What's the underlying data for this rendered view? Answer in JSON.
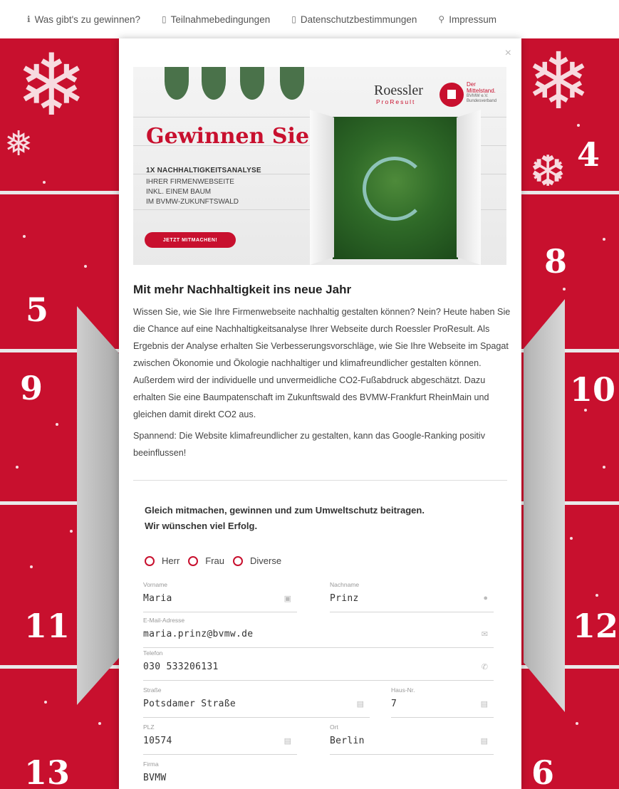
{
  "nav": {
    "items": [
      {
        "icon": "info-icon",
        "glyph": "ℹ",
        "label": "Was gibt's zu gewinnen?"
      },
      {
        "icon": "document-icon",
        "glyph": "🗎",
        "label": "Teilnahmebedingungen"
      },
      {
        "icon": "document-icon",
        "glyph": "🗎",
        "label": "Datenschutzbestimmungen"
      },
      {
        "icon": "people-icon",
        "glyph": "ꓤ",
        "label": "Impressum"
      }
    ]
  },
  "calendar": {
    "numbers": [
      "4",
      "5",
      "8",
      "9",
      "10",
      "11",
      "12",
      "13",
      "6"
    ]
  },
  "modal": {
    "close": "×",
    "banner": {
      "title": "Gewinnen Sie",
      "line1": "1X NACHHALTIGKEITSANALYSE",
      "line2": "IHRER FIRMENWEBSEITE",
      "line3": "INKL. EINEM BAUM",
      "line4": "IM BVMW-ZUKUNFTSWALD",
      "cta": "JETZT MITMACHEN!",
      "logo_roessler": "Roessler",
      "logo_proresult": "ProResult",
      "logo_mittelstand_1": "Der",
      "logo_mittelstand_2": "Mittelstand.",
      "logo_mittelstand_3": "BVMW e.V.",
      "logo_mittelstand_4": "Bundesverband"
    },
    "heading": "Mit mehr Nachhaltigkeit ins neue Jahr",
    "paragraph1": "Wissen Sie, wie Sie Ihre Firmenwebseite nachhaltig gestalten können? Nein? Heute haben Sie die Chance auf eine Nachhaltigkeitsanalyse Ihrer Webseite durch Roessler ProResult. Als Ergebnis der Analyse erhalten Sie Verbesserungsvorschläge, wie Sie Ihre Webseite im Spagat zwischen Ökonomie und Ökologie nachhaltiger und klimafreundlicher gestalten können. Außerdem wird der individuelle und unvermeidliche CO2-Fußabdruck abgeschätzt. Dazu erhalten Sie eine Baumpatenschaft im Zukunftswald des BVMW-Frankfurt RheinMain und gleichen damit direkt CO2 aus.",
    "paragraph2": "Spannend: Die Website klimafreundlicher zu gestalten, kann das Google-Ranking positiv beeinflussen!",
    "cta_line1": "Gleich mitmachen, gewinnen und zum Umweltschutz beitragen.",
    "cta_line2": "Wir wünschen viel Erfolg.",
    "salutation": [
      "Herr",
      "Frau",
      "Diverse"
    ],
    "form": {
      "vorname": {
        "label": "Vorname",
        "value": "Maria",
        "icon": "id-card-icon"
      },
      "nachname": {
        "label": "Nachname",
        "value": "Prinz",
        "icon": "person-icon"
      },
      "email": {
        "label": "E-Mail-Adresse",
        "value": "maria.prinz@bvmw.de",
        "icon": "envelope-icon"
      },
      "telefon": {
        "label": "Telefon",
        "value": "030 533206131",
        "icon": "phone-icon"
      },
      "strasse": {
        "label": "Straße",
        "value": "Potsdamer Straße",
        "icon": "building-icon"
      },
      "hausnr": {
        "label": "Haus-Nr.",
        "value": "7",
        "icon": "building-icon"
      },
      "plz": {
        "label": "PLZ",
        "value": "10574",
        "icon": "building-icon"
      },
      "ort": {
        "label": "Ort",
        "value": "Berlin",
        "icon": "building-icon"
      },
      "firma": {
        "label": "Firma",
        "value": "BVMW"
      }
    }
  }
}
